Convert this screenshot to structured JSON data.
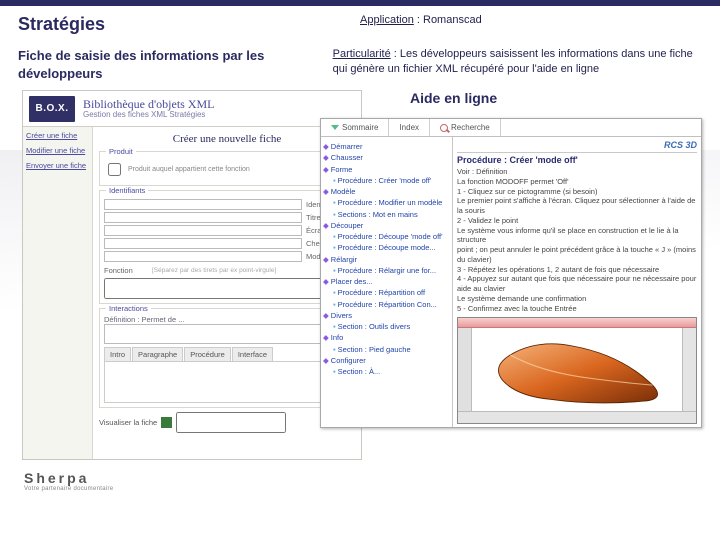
{
  "header": {
    "title": "Stratégies",
    "app_label": "Application",
    "app_name": "Romanscad",
    "part_label": "Particularité",
    "part_text": "Les développeurs saisissent les informations dans une fiche qui génère un fichier XML récupéré pour l'aide en ligne"
  },
  "subtitle": "Fiche de saisie des informations par les développeurs",
  "aide_label": "Aide en ligne",
  "box": {
    "logo": "B.O.X.",
    "title1": "Bibliothèque d'objets XML",
    "title2": "Gestion des fiches XML Stratégies",
    "nav": [
      "Créer une fiche",
      "Modifier une fiche",
      "Envoyer une fiche"
    ],
    "form_title": "Créer une nouvelle fiche",
    "grp_produit": "Produit",
    "produit_hint": "Produit auquel appartient cette fonction",
    "grp_ident": "Identifiants",
    "lbl_identifiant": "Identifiant",
    "lbl_titre": "Titre de",
    "lbl_ecran": "Écran",
    "lbl_chemin": "Chemin",
    "lbl_mode": "Mode de la",
    "lbl_fonction": "Fonction",
    "fonction_hint": "[Séparez par des tirets par ex point-virgule]",
    "grp_interactions": "Interactions",
    "def_label": "Définition : Permet de ...",
    "tabs": [
      "Intro",
      "Paragraphe",
      "Procédure",
      "Interface"
    ],
    "footer_btn": "Visualiser la fiche"
  },
  "help": {
    "tabs": [
      "Sommaire",
      "Index",
      "Recherche"
    ],
    "brand": "RCS 3D",
    "tree": [
      {
        "lvl": 0,
        "t": "Démarrer"
      },
      {
        "lvl": 0,
        "t": "Chausser"
      },
      {
        "lvl": 0,
        "t": "Forme"
      },
      {
        "lvl": 1,
        "t": "Procédure : Créer 'mode off'"
      },
      {
        "lvl": 0,
        "t": "Modèle"
      },
      {
        "lvl": 1,
        "t": "Procédure : Modifier un modèle"
      },
      {
        "lvl": 1,
        "t": "Sections : Mot en mains"
      },
      {
        "lvl": 0,
        "t": "Découper"
      },
      {
        "lvl": 1,
        "t": "Procédure : Découpe 'mode off'"
      },
      {
        "lvl": 1,
        "t": "Procédure : Découpe mode..."
      },
      {
        "lvl": 0,
        "t": "Rélargir"
      },
      {
        "lvl": 1,
        "t": "Procédure : Rélargir une for..."
      },
      {
        "lvl": 0,
        "t": "Placer des..."
      },
      {
        "lvl": 1,
        "t": "Procédure : Répartition off"
      },
      {
        "lvl": 1,
        "t": "Procédure : Répartition Con..."
      },
      {
        "lvl": 0,
        "t": "Divers"
      },
      {
        "lvl": 1,
        "t": "Section : Outils divers"
      },
      {
        "lvl": 0,
        "t": "Info"
      },
      {
        "lvl": 1,
        "t": "Section : Pied gauche"
      },
      {
        "lvl": 0,
        "t": "Configurer"
      },
      {
        "lvl": 1,
        "t": "Section : À..."
      }
    ],
    "doc": {
      "title": "Procédure : Créer 'mode off'",
      "lines": [
        "Voir : Définition",
        "La fonction MODOFF permet 'Off'",
        "1 - Cliquez sur ce pictogramme (si besoin)",
        "Le premier point s'affiche à l'écran. Cliquez pour sélectionner à l'aide de la souris",
        "2 - Validez le point",
        "Le système vous informe qu'il se place en construction et le lie à la structure",
        "point ; on peut annuler le point précédent grâce à la touche « J » (moins du clavier)",
        "3 - Répétez les opérations 1, 2 autant de fois que nécessaire",
        "4 - Appuyez sur autant que fois que nécessaire pour ne nécessaire pour aide au clavier",
        "Le système demande une confirmation",
        "5 - Confirmez avec la touche Entrée"
      ]
    }
  },
  "sherpa": {
    "name": "Sherpa",
    "tag": "Votre partenaire documentaire"
  }
}
